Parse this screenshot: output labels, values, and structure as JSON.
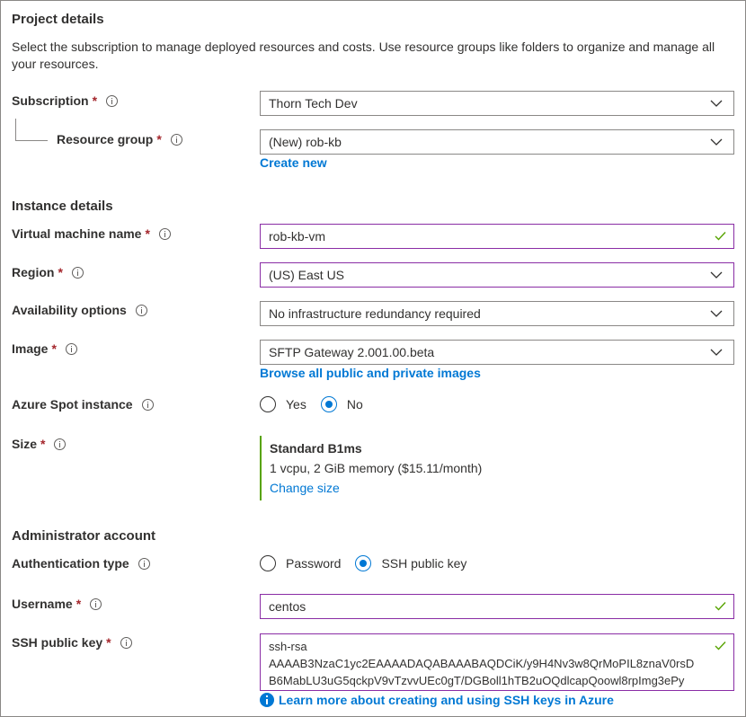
{
  "project": {
    "title": "Project details",
    "description": "Select the subscription to manage deployed resources and costs. Use resource groups like folders to organize and manage all your resources.",
    "subscription": {
      "label": "Subscription",
      "required": "*",
      "value": "Thorn Tech Dev"
    },
    "resource_group": {
      "label": "Resource group",
      "required": "*",
      "value": "(New) rob-kb",
      "create_link": "Create new"
    }
  },
  "instance": {
    "title": "Instance details",
    "vm_name": {
      "label": "Virtual machine name",
      "required": "*",
      "value": "rob-kb-vm"
    },
    "region": {
      "label": "Region",
      "required": "*",
      "value": "(US) East US"
    },
    "availability": {
      "label": "Availability options",
      "value": "No infrastructure redundancy required"
    },
    "image": {
      "label": "Image",
      "required": "*",
      "value": "SFTP Gateway 2.001.00.beta",
      "browse_link": "Browse all public and private images"
    },
    "spot": {
      "label": "Azure Spot instance",
      "options": [
        "Yes",
        "No"
      ],
      "selected": "No"
    },
    "size": {
      "label": "Size",
      "required": "*",
      "name": "Standard B1ms",
      "detail": "1 vcpu, 2 GiB memory ($15.11/month)",
      "change_link": "Change size"
    }
  },
  "admin": {
    "title": "Administrator account",
    "auth": {
      "label": "Authentication type",
      "options": [
        "Password",
        "SSH public key"
      ],
      "selected": "SSH public key"
    },
    "username": {
      "label": "Username",
      "required": "*",
      "value": "centos"
    },
    "ssh_key": {
      "label": "SSH public key",
      "required": "*",
      "value": "ssh-rsa\nAAAAB3NzaC1yc2EAAAADAQABAAABAQDCiK/y9H4Nv3w8QrMoPIL8znaV0rsD\nB6MabLU3uG5qckpV9vTzvvUEc0gT/DGBoll1hTB2uOQdlcapQoowl8rpImg3ePy",
      "learn_link": "Learn more about creating and using SSH keys in Azure"
    }
  },
  "colors": {
    "accent": "#0078d4",
    "required": "#a4262c",
    "valid_border": "#8a2da5",
    "success": "#57a300"
  },
  "icons": {
    "info": "info-icon",
    "dropdown": "chevron-down-icon",
    "valid": "checkmark-icon"
  }
}
